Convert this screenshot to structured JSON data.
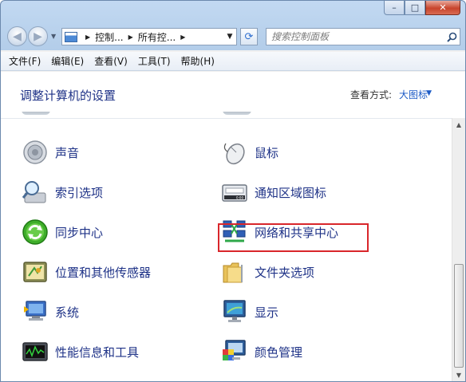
{
  "window": {
    "caption": {
      "minimize": "–",
      "maximize": "□",
      "close": "✕"
    }
  },
  "nav": {
    "back_glyph": "◀",
    "forward_glyph": "▶",
    "breadcrumbs": [
      "控制...",
      "所有控..."
    ],
    "search_placeholder": "搜索控制面板",
    "icons": [
      "back-icon",
      "forward-icon",
      "control-panel-icon",
      "refresh-icon",
      "search-icon"
    ]
  },
  "menu": [
    "文件(F)",
    "编辑(E)",
    "查看(V)",
    "工具(T)",
    "帮助(H)"
  ],
  "header": {
    "title": "调整计算机的设置",
    "view_by_label": "查看方式:",
    "view_by_value": "大图标"
  },
  "items": [
    {
      "label": "声音",
      "icon": "speaker-icon"
    },
    {
      "label": "鼠标",
      "icon": "mouse-icon"
    },
    {
      "label": "索引选项",
      "icon": "indexing-icon"
    },
    {
      "label": "通知区域图标",
      "icon": "notification-area-icon"
    },
    {
      "label": "同步中心",
      "icon": "sync-center-icon"
    },
    {
      "label": "网络和共享中心",
      "icon": "network-sharing-icon",
      "highlighted": true
    },
    {
      "label": "位置和其他传感器",
      "icon": "location-sensors-icon"
    },
    {
      "label": "文件夹选项",
      "icon": "folder-options-icon"
    },
    {
      "label": "系统",
      "icon": "system-icon"
    },
    {
      "label": "显示",
      "icon": "display-icon"
    },
    {
      "label": "性能信息和工具",
      "icon": "performance-icon"
    },
    {
      "label": "颜色管理",
      "icon": "color-management-icon"
    }
  ],
  "colors": {
    "link": "#1e3287",
    "highlight_border": "#d9262b",
    "accent": "#1c5bc6"
  }
}
